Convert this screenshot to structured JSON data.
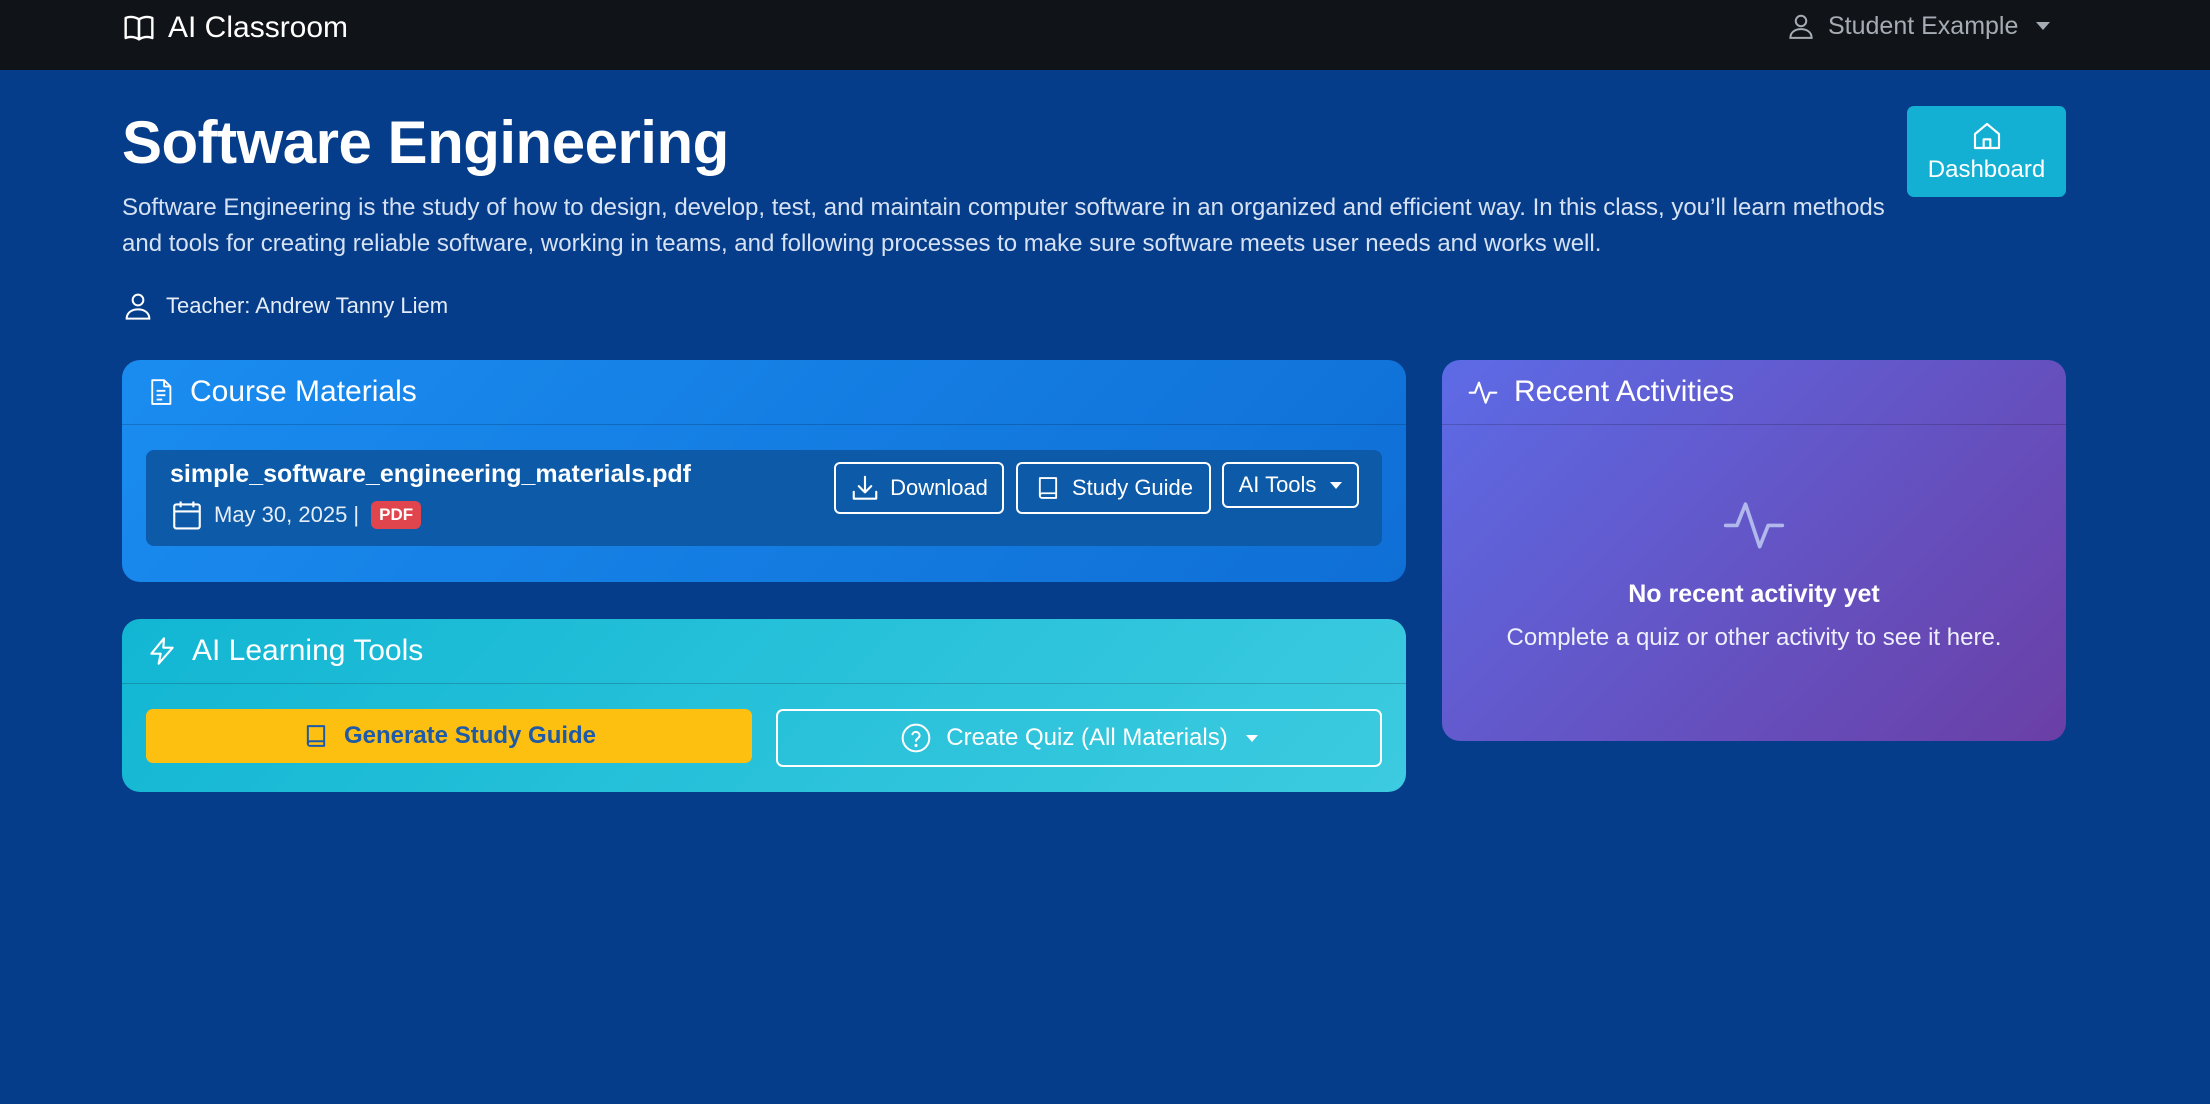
{
  "navbar": {
    "brand": "AI Classroom",
    "user_name": "Student Example"
  },
  "header": {
    "title": "Software Engineering",
    "description": "Software Engineering is the study of how to design, develop, test, and maintain computer software in an organized and efficient way. In this class, you’ll learn methods and tools for creating reliable software, working in teams, and following processes to make sure software meets user needs and works well.",
    "teacher": "Teacher: Andrew Tanny Liem",
    "dashboard_label": "Dashboard"
  },
  "materials": {
    "title": "Course Materials",
    "items": [
      {
        "filename": "simple_software_engineering_materials.pdf",
        "date": "May 30, 2025 |",
        "badge": "PDF",
        "download_label": "Download",
        "study_guide_label": "Study Guide",
        "ai_tools_label": "AI Tools"
      }
    ]
  },
  "ai_tools": {
    "title": "AI Learning Tools",
    "generate_label": "Generate Study Guide",
    "quiz_label": "Create Quiz (All Materials)"
  },
  "activities": {
    "title": "Recent Activities",
    "empty_title": "No recent activity yet",
    "empty_subtitle": "Complete a quiz or other activity to see it here."
  },
  "colors": {
    "page_bg": "#063d8a",
    "navbar_bg": "#101418",
    "dashboard_btn": "#14b0d4",
    "generate_btn": "#fdc010",
    "pdf_badge": "#e0444c"
  },
  "icons": {
    "brand": "open-book-icon",
    "user": "person-icon",
    "dashboard": "house-icon",
    "materials": "document-icon",
    "calendar": "calendar-icon",
    "download": "download-icon",
    "study_guide": "book-icon",
    "ai_tools": "lightning-icon",
    "activities": "activity-pulse-icon",
    "quiz": "question-circle-icon"
  }
}
